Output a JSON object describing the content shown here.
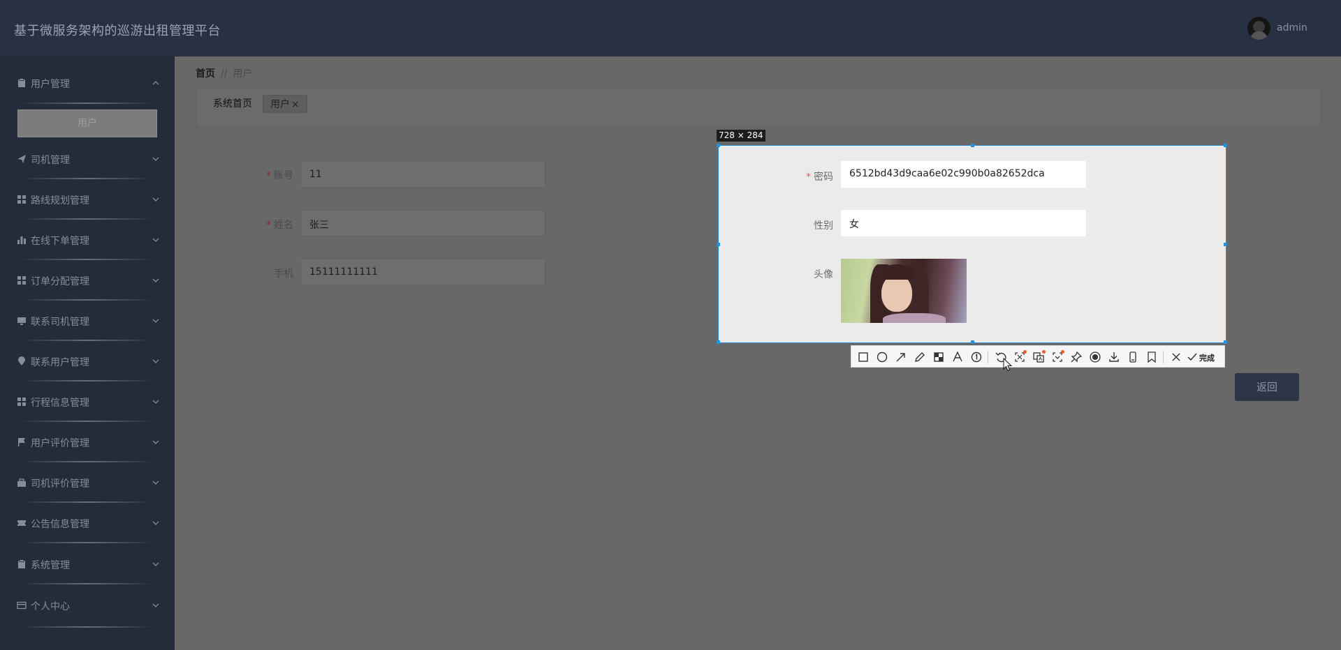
{
  "header": {
    "app_title": "基于微服务架构的巡游出租管理平台",
    "user_name": "admin"
  },
  "sidebar": {
    "items": [
      {
        "label": "用户管理",
        "icon": "clipboard-icon",
        "expanded": true
      },
      {
        "label": "司机管理",
        "icon": "paper-plane-icon"
      },
      {
        "label": "路线规划管理",
        "icon": "grid-icon"
      },
      {
        "label": "在线下单管理",
        "icon": "bar-chart-icon"
      },
      {
        "label": "订单分配管理",
        "icon": "grid-icon"
      },
      {
        "label": "联系司机管理",
        "icon": "monitor-icon"
      },
      {
        "label": "联系用户管理",
        "icon": "map-pin-icon"
      },
      {
        "label": "行程信息管理",
        "icon": "grid-icon"
      },
      {
        "label": "用户评价管理",
        "icon": "flag-icon"
      },
      {
        "label": "司机评价管理",
        "icon": "briefcase-icon"
      },
      {
        "label": "公告信息管理",
        "icon": "ticket-icon"
      },
      {
        "label": "系统管理",
        "icon": "clipboard-icon"
      },
      {
        "label": "个人中心",
        "icon": "card-icon"
      }
    ],
    "submenu": {
      "label": "用户"
    }
  },
  "breadcrumb": {
    "home": "首页",
    "separator": "//",
    "current": "用户"
  },
  "tabs": {
    "home": "系统首页",
    "user": "用户",
    "close": "×"
  },
  "form": {
    "account_label": "账号",
    "account_value": "11",
    "name_label": "姓名",
    "name_value": "张三",
    "phone_label": "手机",
    "phone_value": "15111111111",
    "required_mark": "*",
    "back_label": "返回"
  },
  "screenshot_overlay": {
    "size_label": "728 × 284",
    "password_label": "密码",
    "password_value": "6512bd43d9caa6e02c990b0a82652dca",
    "gender_label": "性别",
    "gender_value": "女",
    "avatar_label": "头像",
    "done_label": "完成",
    "tools": [
      "rectangle-icon",
      "circle-icon",
      "arrow-icon",
      "pencil-icon",
      "mosaic-icon",
      "text-icon",
      "number-icon",
      "undo-icon",
      "ocr-icon",
      "translate-icon",
      "scroll-capture-icon",
      "pin-icon",
      "record-icon",
      "download-icon",
      "phone-icon",
      "bookmark-icon",
      "close-icon",
      "check-icon"
    ],
    "accent_color": "#2a90d8",
    "badge_color": "#f05a28"
  }
}
